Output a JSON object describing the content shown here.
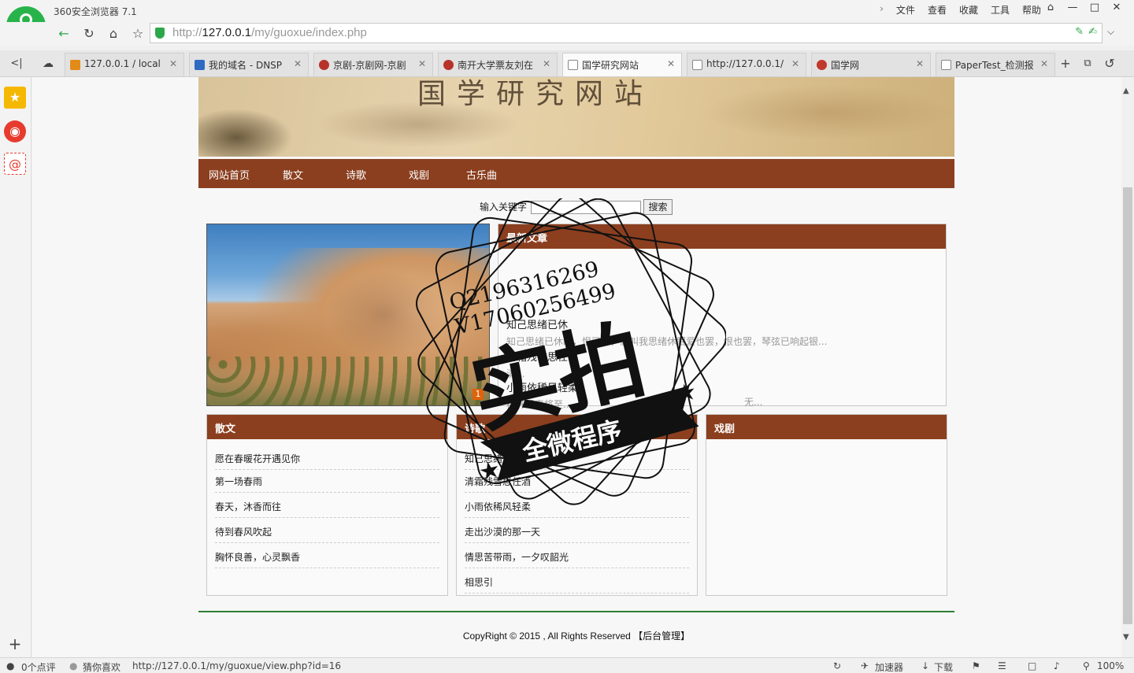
{
  "browser": {
    "app_title": "360安全浏览器 7.1",
    "menu": [
      "文件",
      "查看",
      "收藏",
      "工具",
      "帮助"
    ],
    "url_prefix": "http://",
    "url_host": "127.0.0.1",
    "url_path": "/my/guoxue/index.php",
    "tabs": [
      {
        "label": "127.0.0.1 / local",
        "icon_color": "#e38b16"
      },
      {
        "label": "我的域名 - DNSP",
        "icon_color": "#2f6ac2"
      },
      {
        "label": "京剧-京剧网-京剧",
        "icon_color": "#b7332a"
      },
      {
        "label": "南开大学票友刘在",
        "icon_color": "#b7332a"
      },
      {
        "label": "国学研究网站",
        "icon_color": "#888888"
      },
      {
        "label": "http://127.0.0.1/",
        "icon_color": "#888888"
      },
      {
        "label": "国学网",
        "icon_color": "#c0392b"
      },
      {
        "label": "PaperTest_检测报",
        "icon_color": "#888888"
      }
    ],
    "status": {
      "comments": "0个点评",
      "guess": "猜你喜欢",
      "hover_url": "http://127.0.0.1/my/guoxue/view.php?id=16",
      "accelerator": "加速器",
      "download": "下载",
      "zoom": "100%"
    }
  },
  "site": {
    "banner_title": "国学研究网站",
    "nav": [
      "网站首页",
      "散文",
      "诗歌",
      "戏剧",
      "古乐曲"
    ],
    "search": {
      "label": "输入关键字",
      "value": "",
      "button": "搜索"
    },
    "photo_index": "1",
    "latest": {
      "title": "最新文章",
      "articles": [
        {
          "title": "知己思绪已休",
          "desc": "知己思绪已休眠，恨已怨，怎叫我思绪休眠爱也罢，恨也罢，琴弦已响起银..."
        },
        {
          "title": "清霜残雪思任",
          "desc": "清..."
        },
        {
          "title": "小雨依稀风轻柔",
          "desc": "梅开尽春将至...",
          "extra": "无..."
        }
      ]
    },
    "sections": [
      {
        "title": "散文",
        "items": [
          "愿在春暖花开遇见你",
          "第一场春雨",
          "春天，沐香而往",
          "待到春风吹起",
          "胸怀良善，心灵飘香"
        ]
      },
      {
        "title": "诗歌",
        "items": [
          "知己思绪已休眠",
          "清霜残雪思任酒",
          "小雨依稀风轻柔",
          "走出沙漠的那一天",
          "情思苦带雨，一夕叹韶光",
          "相思引"
        ]
      },
      {
        "title": "戏剧",
        "items": []
      }
    ],
    "footer": {
      "text": "CopyRight © 2015 , All Rights Reserved",
      "admin": "【后台管理】"
    }
  },
  "watermark": {
    "qq": "Q2196316269",
    "wx": "V17060256499",
    "big": "实拍",
    "ribbon": "全微程序"
  }
}
